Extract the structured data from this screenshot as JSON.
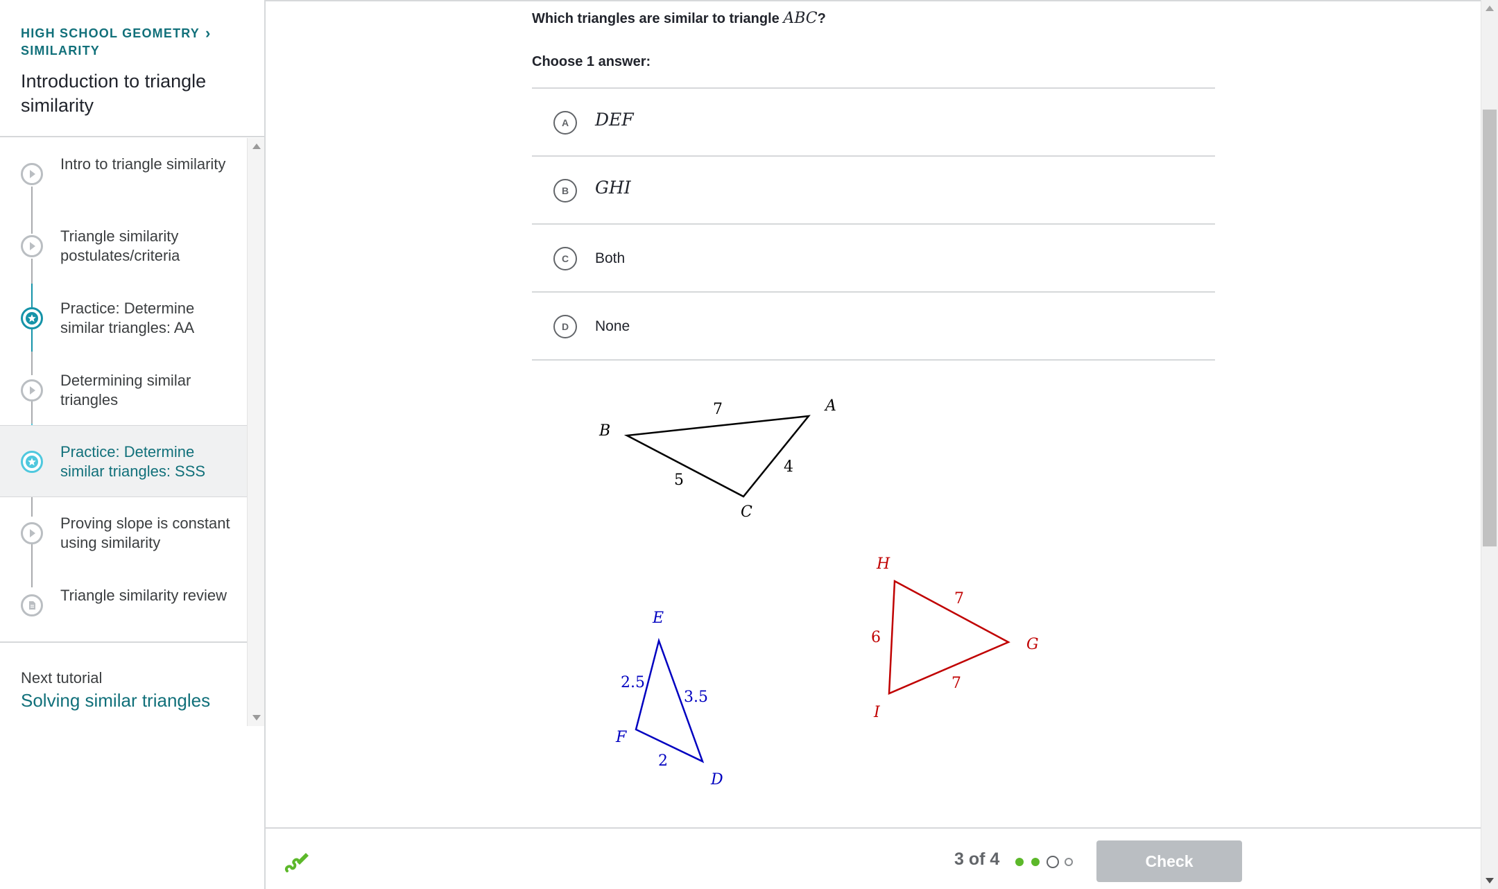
{
  "sidebar": {
    "breadcrumb": {
      "course": "HIGH SCHOOL GEOMETRY",
      "unit": "SIMILARITY"
    },
    "title": "Introduction to triangle similarity",
    "items": [
      {
        "label": "Intro to triangle similarity",
        "icon": "video-play-icon"
      },
      {
        "label": "Triangle similarity postulates/criteria",
        "icon": "video-play-icon"
      },
      {
        "label": "Practice: Determine similar triangles: AA",
        "icon": "practice-star-icon"
      },
      {
        "label": "Determining similar triangles",
        "icon": "video-play-icon"
      },
      {
        "label": "Practice: Determine similar triangles: SSS",
        "icon": "practice-star-icon",
        "active": true
      },
      {
        "label": "Proving slope is constant using similarity",
        "icon": "video-play-icon"
      },
      {
        "label": "Triangle similarity review",
        "icon": "article-icon"
      }
    ],
    "next_tutorial": {
      "label": "Next tutorial",
      "link": "Solving similar triangles"
    }
  },
  "question": {
    "prefix": "Which triangles are similar to triangle ",
    "math": "ABC",
    "suffix": "?",
    "choose_label": "Choose 1 answer:",
    "choices": [
      {
        "letter": "A",
        "text": "DEF",
        "math": true
      },
      {
        "letter": "B",
        "text": "GHI",
        "math": true
      },
      {
        "letter": "C",
        "text": "Both",
        "math": false
      },
      {
        "letter": "D",
        "text": "None",
        "math": false
      }
    ]
  },
  "figure": {
    "triangles": [
      {
        "name": "ABC",
        "color": "#000000",
        "vertices": [
          "A",
          "B",
          "C"
        ],
        "sides": {
          "AB": "7",
          "BC": "5",
          "CA": "4"
        }
      },
      {
        "name": "DEF",
        "color": "#0000c0",
        "vertices": [
          "D",
          "E",
          "F"
        ],
        "sides": {
          "EF": "2.5",
          "ED": "3.5",
          "FD": "2"
        }
      },
      {
        "name": "GHI",
        "color": "#c00000",
        "vertices": [
          "G",
          "H",
          "I"
        ],
        "sides": {
          "HI": "6",
          "HG": "7",
          "IG": "7"
        }
      }
    ]
  },
  "footer": {
    "scratchpad_icon": "scratchpad-pencil-icon",
    "progress": "3 of 4",
    "dots": [
      "complete",
      "complete",
      "current",
      "upcoming"
    ],
    "check_label": "Check"
  },
  "colors": {
    "brand_teal": "#11707a",
    "active_blue": "#1593a8",
    "progress_green": "#5cb82a",
    "disabled_button": "#babec2"
  }
}
